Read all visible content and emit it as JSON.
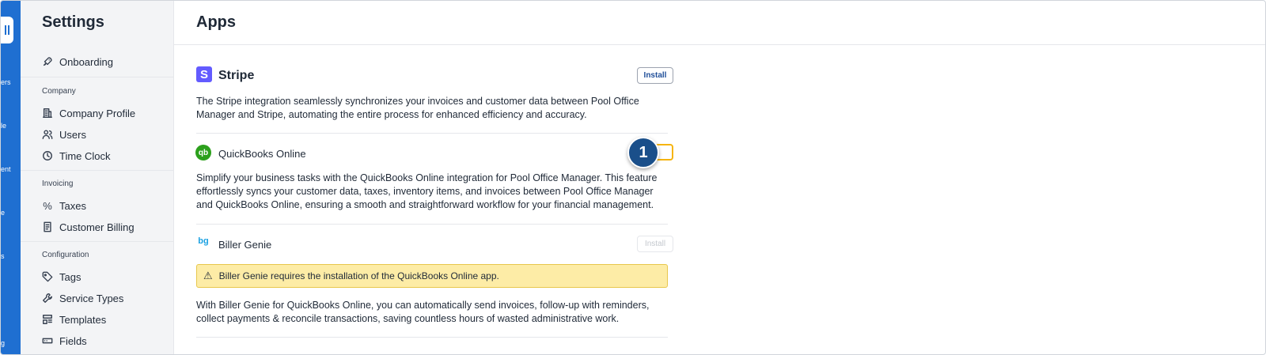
{
  "rail": {
    "fragments": [
      "ers",
      "le",
      "ent",
      "e",
      "s",
      "g"
    ]
  },
  "sidebar": {
    "title": "Settings",
    "onboarding": "Onboarding",
    "sections": {
      "company": "Company",
      "invoicing": "Invoicing",
      "configuration": "Configuration"
    },
    "items": {
      "company_profile": "Company Profile",
      "users": "Users",
      "time_clock": "Time Clock",
      "taxes": "Taxes",
      "customer_billing": "Customer Billing",
      "tags": "Tags",
      "service_types": "Service Types",
      "templates": "Templates",
      "fields": "Fields"
    }
  },
  "main": {
    "title": "Apps",
    "apps": [
      {
        "name": "Stripe",
        "logo": "S",
        "install_label": "Install",
        "description": "The Stripe integration seamlessly synchronizes your invoices and customer data between Pool Office Manager and Stripe, automating the entire process for enhanced efficiency and accuracy."
      },
      {
        "name": "QuickBooks Online",
        "logo": "qb",
        "install_label": "ll",
        "description": "Simplify your business tasks with the QuickBooks Online integration for Pool Office Manager. This feature effortlessly syncs your customer data, taxes, inventory items, and invoices between Pool Office Manager and QuickBooks Online, ensuring a smooth and straightforward workflow for your financial management."
      },
      {
        "name": "Biller Genie",
        "logo": "bg",
        "install_label": "Install",
        "warning": "Biller Genie requires the installation of the QuickBooks Online app.",
        "description": "With Biller Genie for QuickBooks Online, you can automatically send invoices, follow-up with reminders, collect payments & reconcile transactions, saving countless hours of wasted administrative work."
      }
    ]
  },
  "step_badge": "1",
  "colors": {
    "rail": "#1f6fd1",
    "stripe": "#635bff",
    "quickbooks": "#2ca01c",
    "warning_bg": "#fdeca6",
    "highlight": "#f6b40e",
    "badge": "#1a4f8a"
  }
}
